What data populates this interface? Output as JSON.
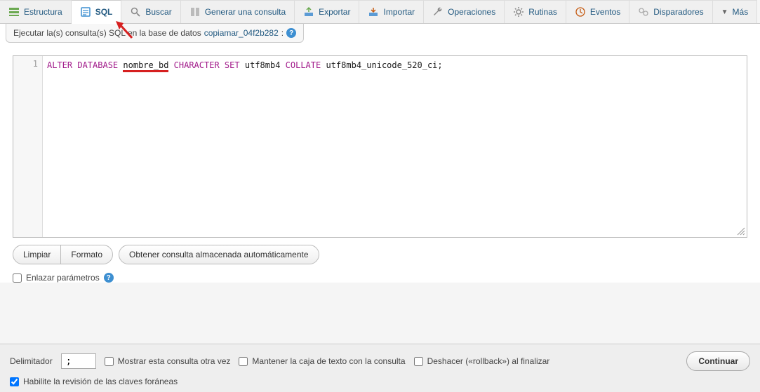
{
  "tabs": {
    "structure": "Estructura",
    "sql": "SQL",
    "search": "Buscar",
    "querygen": "Generar una consulta",
    "export": "Exportar",
    "import": "Importar",
    "operations": "Operaciones",
    "routines": "Rutinas",
    "events": "Eventos",
    "triggers": "Disparadores",
    "more": "Más"
  },
  "header": {
    "prefix": "Ejecutar la(s) consulta(s) SQL en la base de datos ",
    "dbname": "copiamar_04f2b282",
    "suffix": ":"
  },
  "editor": {
    "line_number": "1",
    "sql": {
      "alter": "ALTER",
      "database": "DATABASE",
      "dbident": "nombre_bd",
      "charset_kw1": "CHARACTER",
      "charset_kw2": "SET",
      "charset_val": "utf8mb4",
      "collate_kw": "COLLATE",
      "collate_val": "utf8mb4_unicode_520_ci;"
    }
  },
  "buttons": {
    "clear": "Limpiar",
    "format": "Formato",
    "autosave": "Obtener consulta almacenada automáticamente"
  },
  "bind_params": "Enlazar parámetros",
  "footer": {
    "delimiter_label": "Delimitador",
    "delimiter_value": ";",
    "show_again": "Mostrar esta consulta otra vez",
    "retain_box": "Mantener la caja de texto con la consulta",
    "rollback": "Deshacer («rollback») al finalizar",
    "fk_check": "Habilite la revisión de las claves foráneas",
    "continue": "Continuar"
  }
}
